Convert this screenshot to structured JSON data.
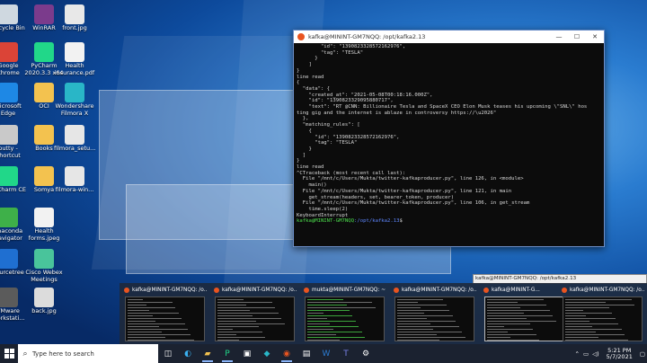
{
  "desktop_icons": [
    {
      "label": "Recycle Bin",
      "icon": "recycle-bin-icon",
      "color": "#cfd8e0"
    },
    {
      "label": "WinRAR",
      "icon": "winrar-icon",
      "color": "#7b3b8c"
    },
    {
      "label": "front.jpg",
      "icon": "image-file-icon",
      "color": "#e8e8e8"
    },
    {
      "label": "Google Chrome",
      "icon": "chrome-icon",
      "color": "#db4437"
    },
    {
      "label": "PyCharm 2020.3.3 x64",
      "icon": "pycharm-icon",
      "color": "#21d789"
    },
    {
      "label": "Health insurance.pdf",
      "icon": "pdf-file-icon",
      "color": "#f2f2f2"
    },
    {
      "label": "Microsoft Edge",
      "icon": "edge-icon",
      "color": "#1e88e5"
    },
    {
      "label": "OCI",
      "icon": "folder-icon",
      "color": "#f3c24f"
    },
    {
      "label": "Wondershare Filmora X",
      "icon": "filmora-icon",
      "color": "#29b6c7"
    },
    {
      "label": "putty - Shortcut",
      "icon": "putty-icon",
      "color": "#c9c9c9"
    },
    {
      "label": "Books",
      "icon": "folder-icon",
      "color": "#f3c24f"
    },
    {
      "label": "filmora_setu...",
      "icon": "installer-icon",
      "color": "#e6e6e6"
    },
    {
      "label": "PyCharm CE",
      "icon": "pycharm-icon",
      "color": "#21d789"
    },
    {
      "label": "Somya",
      "icon": "folder-icon",
      "color": "#f3c24f"
    },
    {
      "label": "filmora-win...",
      "icon": "installer-icon",
      "color": "#e6e6e6"
    },
    {
      "label": "Anaconda Navigator",
      "icon": "anaconda-icon",
      "color": "#3eb049"
    },
    {
      "label": "Health forms.jpeg",
      "icon": "image-file-icon",
      "color": "#f2f2f2"
    },
    {
      "label": "Sourcetree",
      "icon": "sourcetree-icon",
      "color": "#1f6fd1"
    },
    {
      "label": "Cisco Webex Meetings",
      "icon": "webex-icon",
      "color": "#49c49b"
    },
    {
      "label": "VMware Workstati...",
      "icon": "vmware-icon",
      "color": "#5b5b5b"
    },
    {
      "label": "back.jpg",
      "icon": "image-file-icon",
      "color": "#dcdcdc"
    }
  ],
  "terminal": {
    "title": "kafka@MININT-GM7NQQ: /opt/kafka2.13",
    "minimize": "—",
    "maximize": "☐",
    "close": "✕",
    "lines": [
      "        \"id\": \"1390823328572162976\",",
      "        \"tag\": \"TESLA\"",
      "      }",
      "    ]",
      "}",
      "line read",
      "{",
      "  \"data\": {",
      "    \"created_at\": \"2021-05-08T00:18:16.000Z\",",
      "    \"id\": \"1390823329095880717\",",
      "    \"text\": \"RT @CNN: Billionaire Tesla and SpaceX CEO Elon Musk teases his upcoming \\\"SNL\\\" hos",
      "ting gig and the internet is ablaze in controversy https://\\u2026\"",
      "  },",
      "  \"matching_rules\": [",
      "    {",
      "      \"id\": \"1390823328572162976\",",
      "      \"tag\": \"TESLA\"",
      "    }",
      "  ]",
      "}",
      "line read",
      "^CTraceback (most recent call last):",
      "  File \"/mnt/c/Users/Mukta/twitter-kafkaproducer.py\", line 126, in <module>",
      "    main()",
      "  File \"/mnt/c/Users/Mukta/twitter-kafkaproducer.py\", line 121, in main",
      "    get_stream(headers, set, bearer_token, producer)",
      "  File \"/mnt/c/Users/Mukta/twitter-kafkaproducer.py\", line 106, in get_stream",
      "    time.sleep(2)",
      "KeyboardInterrupt"
    ],
    "prompt_user": "kafka@MININT-GM7NQQ",
    "prompt_path": ":/opt/kafka2.13",
    "prompt_symbol": "$"
  },
  "tooltip": "kafka@MININT-GM7NQQ: /opt/kafka2.13",
  "thumbnails": [
    {
      "label": "kafka@MININT-GM7NQQ: /o..."
    },
    {
      "label": "kafka@MININT-GM7NQQ: /o..."
    },
    {
      "label": "mukta@MININT-GM7NQQ: ~"
    },
    {
      "label": "kafka@MININT-GM7NQQ: /o..."
    },
    {
      "label": "kafka@MININT-G..."
    },
    {
      "label": "kafka@MININT-GM7NQQ: /o..."
    }
  ],
  "taskbar": {
    "search_placeholder": "Type here to search",
    "apps": [
      "task-view-icon",
      "edge-icon",
      "folder-icon",
      "pycharm-icon",
      "terminal-icon",
      "filmora-icon",
      "ubuntu-icon",
      "notepad-icon",
      "word-icon",
      "teams-icon",
      "settings-icon"
    ],
    "time": "5:21 PM",
    "date": "5/7/2021"
  }
}
